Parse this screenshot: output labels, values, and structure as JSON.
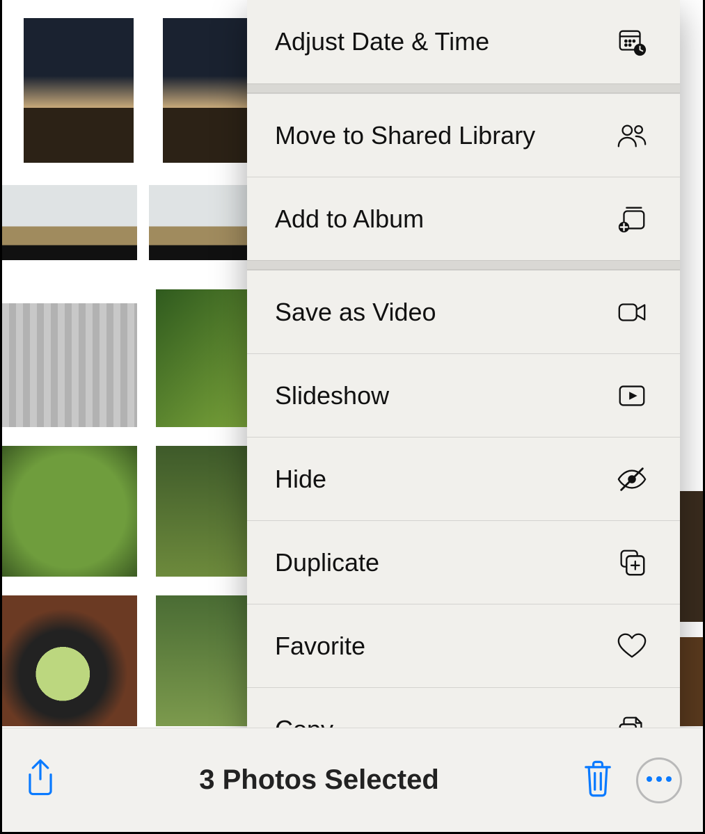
{
  "menu": {
    "items": [
      {
        "label": "Adjust Date & Time",
        "icon": "calendar-clock-icon"
      },
      {
        "label": "Move to Shared Library",
        "icon": "people-icon"
      },
      {
        "label": "Add to Album",
        "icon": "album-add-icon"
      },
      {
        "label": "Save as Video",
        "icon": "video-icon"
      },
      {
        "label": "Slideshow",
        "icon": "play-rect-icon"
      },
      {
        "label": "Hide",
        "icon": "eye-slash-icon"
      },
      {
        "label": "Duplicate",
        "icon": "duplicate-icon"
      },
      {
        "label": "Favorite",
        "icon": "heart-icon"
      },
      {
        "label": "Copy",
        "icon": "copy-docs-icon"
      }
    ]
  },
  "toolbar": {
    "selection_label": "3 Photos Selected"
  },
  "colors": {
    "accent": "#0a7aff",
    "menu_bg": "#f1f0ec",
    "menu_gap": "#d9d8d4",
    "toolbar_bg": "#f2f1ee"
  }
}
